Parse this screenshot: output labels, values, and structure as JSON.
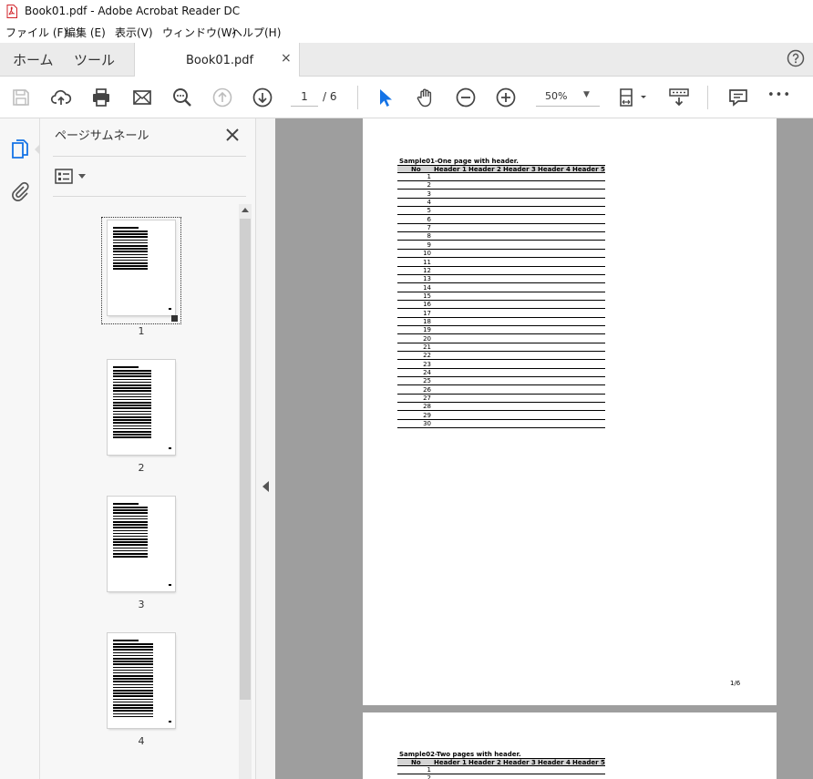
{
  "window": {
    "title": "Book01.pdf - Adobe Acrobat Reader DC"
  },
  "menu": [
    "ファイル (F)",
    "編集 (E)",
    "表示(V)",
    "ウィンドウ(W)",
    "ヘルプ(H)"
  ],
  "tabs": {
    "home": "ホーム",
    "tools": "ツール",
    "document": "Book01.pdf",
    "close": "×"
  },
  "toolbar": {
    "page_current": "1",
    "page_total": "/ 6",
    "zoom": "50%",
    "zoom_caret": "▼",
    "more": "•••"
  },
  "panel": {
    "title": "ページサムネール",
    "thumbnails": [
      {
        "label": "1",
        "selected": true
      },
      {
        "label": "2",
        "selected": false
      },
      {
        "label": "3",
        "selected": false
      },
      {
        "label": "4",
        "selected": false
      }
    ]
  },
  "document": {
    "page1": {
      "title": "Sample01-One page with header.",
      "headers": [
        "No",
        "Header 1",
        "Header 2",
        "Header 3",
        "Header 4",
        "Header 5"
      ],
      "rows": [
        "1",
        "2",
        "3",
        "4",
        "5",
        "6",
        "7",
        "8",
        "9",
        "10",
        "11",
        "12",
        "13",
        "14",
        "15",
        "16",
        "17",
        "18",
        "19",
        "20",
        "21",
        "22",
        "23",
        "24",
        "25",
        "26",
        "27",
        "28",
        "29",
        "30"
      ],
      "footer": "1/6"
    },
    "page2": {
      "title": "Sample02-Two pages with header.",
      "headers": [
        "No",
        "Header 1",
        "Header 2",
        "Header 3",
        "Header 4",
        "Header 5"
      ],
      "rows": [
        "1",
        "2"
      ]
    }
  },
  "colors": {
    "accent": "#1473e6",
    "workspace": "#9e9e9e",
    "panel": "#f7f7f7"
  }
}
